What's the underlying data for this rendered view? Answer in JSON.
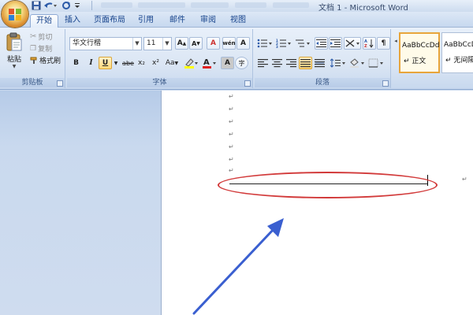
{
  "window": {
    "title": "文档 1 - Microsoft Word"
  },
  "tabs": [
    {
      "label": "开始",
      "active": true
    },
    {
      "label": "插入"
    },
    {
      "label": "页面布局"
    },
    {
      "label": "引用"
    },
    {
      "label": "邮件"
    },
    {
      "label": "审阅"
    },
    {
      "label": "视图"
    }
  ],
  "clipboard": {
    "group_label": "剪贴板",
    "paste_label": "粘贴",
    "cut_label": "剪切",
    "copy_label": "复制",
    "format_painter_label": "格式刷"
  },
  "font": {
    "group_label": "字体",
    "font_name": "华文行楷",
    "font_size": "11",
    "bold": "B",
    "italic": "I",
    "underline": "U",
    "strike": "abe",
    "subscript": "x₂",
    "superscript": "x²",
    "change_case": "Aa",
    "grow": "A",
    "shrink": "A",
    "clear_format": "A",
    "phonetic": "wén",
    "char_border": "A",
    "char_shading": "A",
    "enclosed": "字"
  },
  "paragraph": {
    "group_label": "段落"
  },
  "styles": {
    "items": [
      {
        "sample": "AaBbCcDd",
        "name": "正文",
        "selected": true
      },
      {
        "sample": "AaBbCcD",
        "name": "无间隔"
      }
    ]
  },
  "colors": {
    "accent_red": "#d23a3a",
    "arrow_blue": "#3a5fd0",
    "ribbon_text": "#15428b"
  }
}
